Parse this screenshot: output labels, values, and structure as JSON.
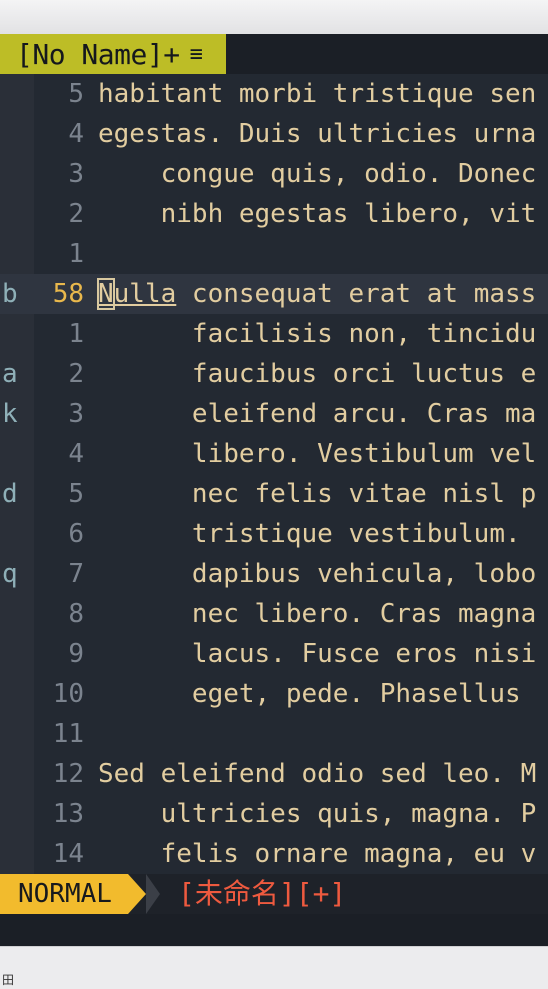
{
  "tabline": {
    "active_tab": "[No Name]+",
    "menu_icon": "≡"
  },
  "editor": {
    "lines": [
      {
        "mark": "",
        "num": "5",
        "text": "habitant morbi tristique sen"
      },
      {
        "mark": "",
        "num": "4",
        "text": "egestas. Duis ultricies urna"
      },
      {
        "mark": "",
        "num": "3",
        "text": "    congue quis, odio. Donec"
      },
      {
        "mark": "",
        "num": "2",
        "text": "    nibh egestas libero, vit"
      },
      {
        "mark": "",
        "num": "1",
        "text": ""
      },
      {
        "mark": "b",
        "num": "58",
        "text": "",
        "current": true
      },
      {
        "mark": "",
        "num": "1",
        "text": "      facilisis non, tincidu"
      },
      {
        "mark": "a",
        "num": "2",
        "text": "      faucibus orci luctus e"
      },
      {
        "mark": "k",
        "num": "3",
        "text": "      eleifend arcu. Cras ma"
      },
      {
        "mark": "",
        "num": "4",
        "text": "      libero. Vestibulum vel"
      },
      {
        "mark": "d",
        "num": "5",
        "text": "      nec felis vitae nisl p"
      },
      {
        "mark": "",
        "num": "6",
        "text": "      tristique vestibulum. "
      },
      {
        "mark": "q",
        "num": "7",
        "text": "      dapibus vehicula, lobo"
      },
      {
        "mark": "",
        "num": "8",
        "text": "      nec libero. Cras magna"
      },
      {
        "mark": "",
        "num": "9",
        "text": "      lacus. Fusce eros nisi"
      },
      {
        "mark": "",
        "num": "10",
        "text": "      eget, pede. Phasellus "
      },
      {
        "mark": "",
        "num": "11",
        "text": ""
      },
      {
        "mark": "",
        "num": "12",
        "text": "Sed eleifend odio sed leo. M"
      },
      {
        "mark": "",
        "num": "13",
        "text": "    ultricies quis, magna. P"
      },
      {
        "mark": "",
        "num": "14",
        "text": "    felis ornare magna, eu v"
      }
    ],
    "current_line": {
      "cursor_char": "N",
      "word_rest": "ulla",
      "rest": " consequat erat at mass"
    }
  },
  "statusline": {
    "mode": "NORMAL",
    "filename": "[未命名][+]"
  },
  "taskbar": {
    "ime_icon": "田"
  }
}
